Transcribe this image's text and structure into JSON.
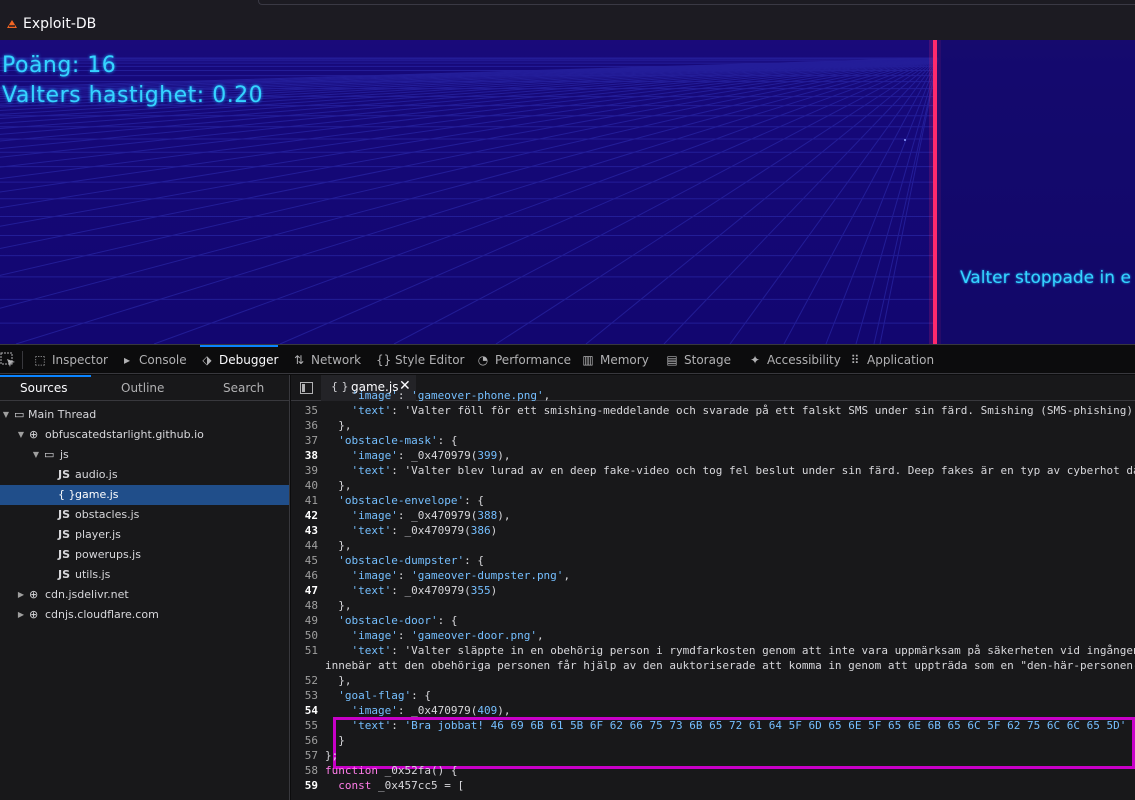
{
  "window": {
    "title": "Exploit-DB"
  },
  "game": {
    "score_text": "Poäng: 16",
    "speed_text": "Valters hastighet: 0.20",
    "message": "Valter stoppade in e"
  },
  "devtools": {
    "tabs": [
      {
        "label": "Inspector",
        "icon": "inspector-icon"
      },
      {
        "label": "Console",
        "icon": "console-icon"
      },
      {
        "label": "Debugger",
        "icon": "debugger-icon"
      },
      {
        "label": "Network",
        "icon": "network-icon"
      },
      {
        "label": "Style Editor",
        "icon": "style-editor-icon"
      },
      {
        "label": "Performance",
        "icon": "performance-icon"
      },
      {
        "label": "Memory",
        "icon": "memory-icon"
      },
      {
        "label": "Storage",
        "icon": "storage-icon"
      },
      {
        "label": "Accessibility",
        "icon": "accessibility-icon"
      },
      {
        "label": "Application",
        "icon": "application-icon"
      }
    ],
    "selected_tab": "Debugger"
  },
  "sources": {
    "tabs": [
      "Sources",
      "Outline",
      "Search"
    ],
    "selected": "Sources",
    "tree": [
      {
        "label": "Main Thread",
        "type": "thread",
        "depth": 0,
        "expanded": true
      },
      {
        "label": "obfuscatedstarlight.github.io",
        "type": "domain",
        "depth": 1,
        "expanded": true
      },
      {
        "label": "js",
        "type": "folder",
        "depth": 2,
        "expanded": true
      },
      {
        "label": "audio.js",
        "type": "js",
        "depth": 3
      },
      {
        "label": "game.js",
        "type": "pretty",
        "depth": 3,
        "selected": true
      },
      {
        "label": "obstacles.js",
        "type": "js",
        "depth": 3
      },
      {
        "label": "player.js",
        "type": "js",
        "depth": 3
      },
      {
        "label": "powerups.js",
        "type": "js",
        "depth": 3
      },
      {
        "label": "utils.js",
        "type": "js",
        "depth": 3
      },
      {
        "label": "cdn.jsdelivr.net",
        "type": "domain",
        "depth": 1,
        "expanded": false
      },
      {
        "label": "cdnjs.cloudflare.com",
        "type": "domain",
        "depth": 1,
        "expanded": false
      }
    ]
  },
  "editor": {
    "file_tab": "game.js",
    "lines": [
      {
        "n": "",
        "t": "    'image': 'gameover-phone.png',"
      },
      {
        "n": "35",
        "t": "    'text': 'Valter föll för ett smishing-meddelande och svarade på ett falskt SMS under sin färd. Smishing (SMS-phishing)"
      },
      {
        "n": "36",
        "t": "  },"
      },
      {
        "n": "37",
        "t": "  'obstacle-mask': {"
      },
      {
        "n": "38",
        "t": "    'image': _0x470979(399),",
        "bp": true
      },
      {
        "n": "39",
        "t": "    'text': 'Valter blev lurad av en deep fake-video och tog fel beslut under sin färd. Deep fakes är en typ av cyberhot då"
      },
      {
        "n": "40",
        "t": "  },"
      },
      {
        "n": "41",
        "t": "  'obstacle-envelope': {"
      },
      {
        "n": "42",
        "t": "    'image': _0x470979(388),",
        "bp": true
      },
      {
        "n": "43",
        "t": "    'text': _0x470979(386)",
        "bp": true
      },
      {
        "n": "44",
        "t": "  },"
      },
      {
        "n": "45",
        "t": "  'obstacle-dumpster': {"
      },
      {
        "n": "46",
        "t": "    'image': 'gameover-dumpster.png',"
      },
      {
        "n": "47",
        "t": "    'text': _0x470979(355)",
        "bp": true
      },
      {
        "n": "48",
        "t": "  },"
      },
      {
        "n": "49",
        "t": "  'obstacle-door': {"
      },
      {
        "n": "50",
        "t": "    'image': 'gameover-door.png',"
      },
      {
        "n": "51",
        "t": "    'text': 'Valter släppte in en obehörig person i rymdfarkosten genom att inte vara uppmärksam på säkerheten vid ingången"
      },
      {
        "n": "",
        "t": "innebär att den obehöriga personen får hjälp av den auktoriserade att komma in genom att uppträda som en \"den-här-personen-"
      },
      {
        "n": "52",
        "t": "  },"
      },
      {
        "n": "53",
        "t": "  'goal-flag': {"
      },
      {
        "n": "54",
        "t": "    'image': _0x470979(409),",
        "bp": true
      },
      {
        "n": "55",
        "t": "    'text': 'Bra jobbat! 46 69 6B 61 5B 6F 62 66 75 73 6B 65 72 61 64 5F 6D 65 6E 5F 65 6E 6B 65 6C 5F 62 75 6C 6C 65 5D'"
      },
      {
        "n": "56",
        "t": "  }"
      },
      {
        "n": "57",
        "t": "};"
      },
      {
        "n": "58",
        "t": "function _0x52fa() {"
      },
      {
        "n": "59",
        "t": "  const _0x457cc5 = [",
        "bp": true
      }
    ]
  },
  "colors": {
    "game_bg": "#14086e",
    "neon": "#35d4ff",
    "laser": "#ff2a6d",
    "highlight": "#c800c8",
    "accent": "#0a84ff"
  }
}
